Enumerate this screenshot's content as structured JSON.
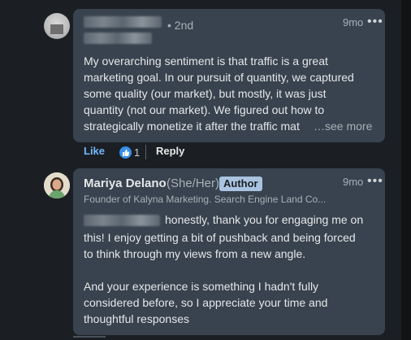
{
  "comment1": {
    "degree": "• 2nd",
    "time": "9mo",
    "more": "•••",
    "body": "My overarching sentiment is that traffic is a great\nmarketing goal. In our pursuit of quantity, we captured\nsome quality (our market), but mostly, it was just\nquantity (not our market). We figured out how to\nstrategically monetize it after the traffic mat",
    "see_more": "…see more",
    "like_label": "Like",
    "reaction_count": "1",
    "reply_label": "Reply"
  },
  "comment2": {
    "name": "Mariya Delano",
    "pronouns": "(She/Her)",
    "badge": "Author",
    "time": "9mo",
    "more": "•••",
    "headline": "Founder of Kalyna Marketing. Search Engine Land Co...",
    "body_first": "honestly, thank you for engaging me on",
    "body_rest": "this! I enjoy getting a bit of pushback and being forced\nto think through my views from a new angle.\n\nAnd your experience is something I hadn't fully\nconsidered before, so I appreciate your time and\nthoughtful responses"
  },
  "colors": {
    "background": "#1b1f23",
    "bubble": "#38434f",
    "link_blue": "#71b7fb",
    "badge": "#a9c3e0"
  }
}
